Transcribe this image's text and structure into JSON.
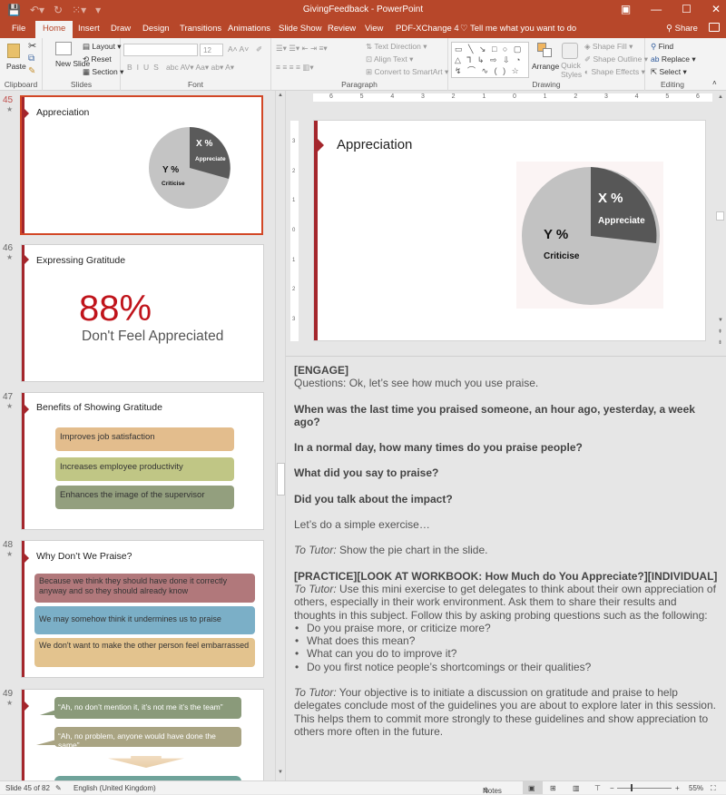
{
  "window": {
    "title": "GivingFeedback  -  PowerPoint",
    "controls": [
      "restore-ribbon",
      "minimize",
      "maximize",
      "close"
    ]
  },
  "quick_access": [
    "save",
    "undo",
    "redo",
    "start-from-beginning",
    "customize"
  ],
  "tabs": [
    {
      "label": "File",
      "active": false
    },
    {
      "label": "Home",
      "active": true
    },
    {
      "label": "Insert",
      "active": false
    },
    {
      "label": "Draw",
      "active": false
    },
    {
      "label": "Design",
      "active": false
    },
    {
      "label": "Transitions",
      "active": false
    },
    {
      "label": "Animations",
      "active": false
    },
    {
      "label": "Slide Show",
      "active": false
    },
    {
      "label": "Review",
      "active": false
    },
    {
      "label": "View",
      "active": false
    },
    {
      "label": "PDF-XChange 4",
      "active": false
    }
  ],
  "tell_me": "Tell me what you want to do",
  "share": "Share",
  "ribbon": {
    "clipboard": {
      "label": "Clipboard",
      "paste": "Paste"
    },
    "slides": {
      "label": "Slides",
      "new_slide": "New Slide",
      "layout": "Layout",
      "reset": "Reset",
      "section": "Section"
    },
    "font": {
      "label": "Font",
      "font_name": "",
      "font_size": "12",
      "buttons": [
        "B",
        "I",
        "U",
        "S",
        "abc",
        "AV",
        "Aa",
        "A"
      ]
    },
    "paragraph": {
      "label": "Paragraph",
      "text_direction": "Text Direction",
      "align_text": "Align Text",
      "convert_smartart": "Convert to SmartArt"
    },
    "drawing": {
      "label": "Drawing",
      "arrange": "Arrange",
      "quick_styles": "Quick Styles",
      "shape_fill": "Shape Fill",
      "shape_outline": "Shape Outline",
      "shape_effects": "Shape Effects",
      "shapes_row1": "▭ ╲ ↘ □ ○ ▢",
      "shapes_row2": "△ ⅂ ↳ ⇨ ⇩ ◔",
      "shapes_row3": "↯ ⌒ ∿ ( ) ☆"
    },
    "editing": {
      "label": "Editing",
      "find": "Find",
      "replace": "Replace",
      "select": "Select"
    }
  },
  "thumbnails": [
    {
      "number": "45",
      "title": "Appreciation",
      "selected": true,
      "pie": {
        "x_label": "X %",
        "x_sub": "Appreciate",
        "y_label": "Y %",
        "y_sub": "Criticise"
      }
    },
    {
      "number": "46",
      "title": "Expressing Gratitude",
      "big_stat": "88%",
      "stat_caption": "Don't Feel Appreciated"
    },
    {
      "number": "47",
      "title": "Benefits of Showing Gratitude",
      "items": [
        {
          "text": "Improves job satisfaction",
          "color": "#e3bd8d"
        },
        {
          "text": "Increases employee productivity",
          "color": "#c0c685"
        },
        {
          "text": "Enhances the image of the supervisor",
          "color": "#939f7e"
        }
      ]
    },
    {
      "number": "48",
      "title": "Why Don’t We Praise?",
      "items": [
        {
          "text": "Because we think they should have done it correctly anyway and so they should already know",
          "color": "#b1787b"
        },
        {
          "text": "We may somehow think it undermines us to praise",
          "color": "#7bafc7"
        },
        {
          "text": "We don't want to make the other person feel embarrassed",
          "color": "#e3c38e"
        }
      ]
    },
    {
      "number": "49",
      "items": [
        {
          "text": "“Ah, no don’t mention it, it’s not me it’s the team”",
          "color": "#8a9a7a"
        },
        {
          "text": "“Ah, no problem, anyone would have done the same”",
          "color": "#a9a483"
        }
      ]
    }
  ],
  "main_slide": {
    "title": "Appreciation",
    "pie": {
      "x_label": "X %",
      "x_sub": "Appreciate",
      "y_label": "Y %",
      "y_sub": "Criticise"
    }
  },
  "ruler": {
    "h_ticks": [
      "6",
      "5",
      "4",
      "3",
      "2",
      "1",
      "0",
      "1",
      "2",
      "3",
      "4",
      "5",
      "6"
    ],
    "v_ticks": [
      "3",
      "2",
      "1",
      "0",
      "1",
      "2",
      "3"
    ]
  },
  "notes": {
    "engage": "[ENGAGE]",
    "questions": "Questions:  Ok, let’s see how much you use praise.",
    "q1": "When was the last time you praised someone, an hour ago, yesterday, a week ago?",
    "q2": "In a normal day, how many times do you praise people?",
    "q3": "What did you say to praise?",
    "q4": "Did you talk about the impact?",
    "exercise": "Let’s do a simple exercise…",
    "tutor_label": "To Tutor:",
    "tutor1": " Show the pie chart in the slide.",
    "practice": "[PRACTICE][LOOK AT WORKBOOK: How Much do You Appreciate?][INDIVIDUAL]",
    "tutor2": " Use this mini exercise to get delegates to think about their own appreciation of others, especially in their work environment. Ask them to share their results and thoughts in this subject. Follow this by asking probing questions such as the following:",
    "bullets": [
      "Do you praise more, or criticize more?",
      "What does this mean?",
      "What can you do to improve it?",
      "Do you first notice people’s shortcomings or their qualities?"
    ],
    "tutor3": " Your objective is to initiate a discussion on gratitude and praise to help delegates conclude most of the guidelines you are about to explore later in this session. This helps them to commit more strongly to these guidelines and show appreciation to others more often in the future."
  },
  "status": {
    "slide_info": "Slide 45 of 82",
    "language": "English (United Kingdom)",
    "notes_btn": "Notes",
    "zoom": "55%"
  },
  "colors": {
    "accent": "#b7472a",
    "slide_bar": "#a4262c",
    "stat_red": "#c0141b"
  }
}
